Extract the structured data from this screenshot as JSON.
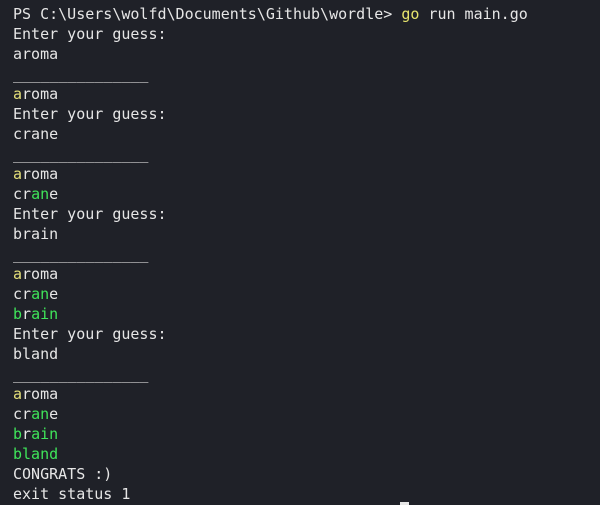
{
  "prompt": {
    "prefix": "PS C:\\Users\\wolfd\\Documents\\Github\\wordle> ",
    "command": "go",
    "args": " run main.go"
  },
  "prompt_text": "Enter your guess:",
  "separator": "_______________",
  "guesses": [
    "aroma",
    "crane",
    "brain",
    "bland"
  ],
  "board": {
    "aroma": [
      {
        "ch": "a",
        "color": "yellow"
      },
      {
        "ch": "roma",
        "color": "white"
      }
    ],
    "crane": [
      {
        "ch": "cr",
        "color": "white"
      },
      {
        "ch": "an",
        "color": "green"
      },
      {
        "ch": "e",
        "color": "white"
      }
    ],
    "brain": [
      {
        "ch": "b",
        "color": "green"
      },
      {
        "ch": "r",
        "color": "white"
      },
      {
        "ch": "ain",
        "color": "green"
      }
    ],
    "bland": [
      {
        "ch": "bland",
        "color": "green"
      }
    ]
  },
  "congrats": "CONGRATS :)",
  "exit": "exit status 1",
  "colors": {
    "background": "#1f2128",
    "text": "#e6e6e6",
    "yellow": "#e5e07a",
    "green": "#3fe55a",
    "command": "#e7e56d"
  }
}
